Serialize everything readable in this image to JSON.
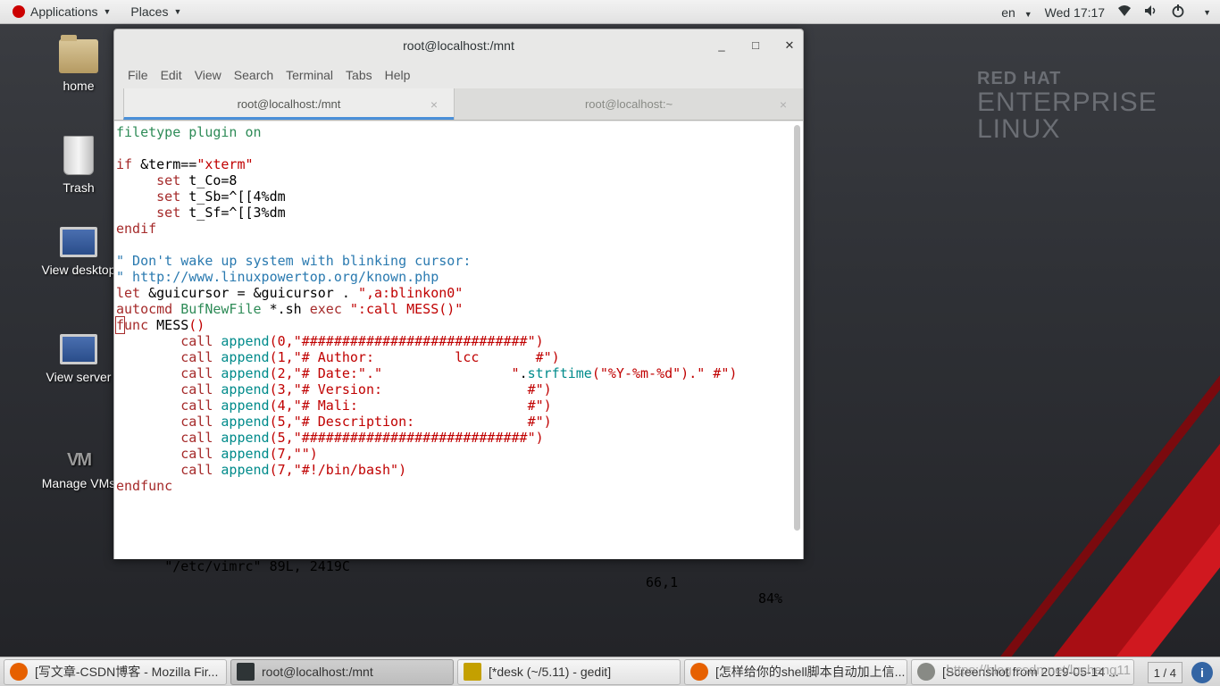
{
  "topbar": {
    "applications": "Applications",
    "places": "Places",
    "lang": "en",
    "clock": "Wed 17:17"
  },
  "desktop": {
    "branding": {
      "line1": "RED HAT",
      "line2": "ENTERPRISE",
      "line3": "LINUX"
    },
    "icons": [
      {
        "label": "home"
      },
      {
        "label": "Trash"
      },
      {
        "label": "View desktop"
      },
      {
        "label": "View server"
      },
      {
        "label": "Manage VMs"
      }
    ]
  },
  "window": {
    "title": "root@localhost:/mnt",
    "menu": [
      "File",
      "Edit",
      "View",
      "Search",
      "Terminal",
      "Tabs",
      "Help"
    ],
    "tabs": [
      {
        "label": "root@localhost:/mnt",
        "close": "×"
      },
      {
        "label": "root@localhost:~",
        "close": "×"
      }
    ],
    "vim": {
      "lines": [
        [
          {
            "t": "filetype plugin on",
            "c": "tp"
          }
        ],
        [],
        [
          {
            "t": "if",
            "c": "kw"
          },
          {
            "t": " &term==",
            "c": ""
          },
          {
            "t": "\"xterm\"",
            "c": "str"
          }
        ],
        [
          {
            "t": "     ",
            "c": ""
          },
          {
            "t": "set",
            "c": "kw"
          },
          {
            "t": " t_Co=8",
            "c": ""
          }
        ],
        [
          {
            "t": "     ",
            "c": ""
          },
          {
            "t": "set",
            "c": "kw"
          },
          {
            "t": " t_Sb=^[[4%dm",
            "c": ""
          }
        ],
        [
          {
            "t": "     ",
            "c": ""
          },
          {
            "t": "set",
            "c": "kw"
          },
          {
            "t": " t_Sf=^[[3%dm",
            "c": ""
          }
        ],
        [
          {
            "t": "endif",
            "c": "kw"
          }
        ],
        [],
        [
          {
            "t": "\" Don't wake up system with blinking cursor:",
            "c": "cm"
          }
        ],
        [
          {
            "t": "\" http://www.linuxpowertop.org/known.php",
            "c": "cm"
          }
        ],
        [
          {
            "t": "let",
            "c": "kw"
          },
          {
            "t": " &guicursor = &guicursor . ",
            "c": ""
          },
          {
            "t": "\",a:blinkon0\"",
            "c": "str"
          }
        ],
        [
          {
            "t": "autocmd",
            "c": "kw"
          },
          {
            "t": " ",
            "c": ""
          },
          {
            "t": "BufNewFile",
            "c": "tp"
          },
          {
            "t": " *.sh ",
            "c": ""
          },
          {
            "t": "exec",
            "c": "kw"
          },
          {
            "t": " ",
            "c": ""
          },
          {
            "t": "\":call MESS()\"",
            "c": "str"
          }
        ],
        [
          {
            "t": "f",
            "c": "kw cursor"
          },
          {
            "t": "unc",
            "c": "kw"
          },
          {
            "t": " MESS",
            "c": ""
          },
          {
            "t": "()",
            "c": "str"
          }
        ],
        [
          {
            "t": "        ",
            "c": ""
          },
          {
            "t": "call",
            "c": "kw"
          },
          {
            "t": " ",
            "c": ""
          },
          {
            "t": "append",
            "c": "fn"
          },
          {
            "t": "(0,",
            "c": "str"
          },
          {
            "t": "\"############################\"",
            "c": "str"
          },
          {
            "t": ")",
            "c": "str"
          }
        ],
        [
          {
            "t": "        ",
            "c": ""
          },
          {
            "t": "call",
            "c": "kw"
          },
          {
            "t": " ",
            "c": ""
          },
          {
            "t": "append",
            "c": "fn"
          },
          {
            "t": "(1,",
            "c": "str"
          },
          {
            "t": "\"# Author:          lcc       #\"",
            "c": "str"
          },
          {
            "t": ")",
            "c": "str"
          }
        ],
        [
          {
            "t": "        ",
            "c": ""
          },
          {
            "t": "call",
            "c": "kw"
          },
          {
            "t": " ",
            "c": ""
          },
          {
            "t": "append",
            "c": "fn"
          },
          {
            "t": "(2,",
            "c": "str"
          },
          {
            "t": "\"# Date:\".\"                \"",
            "c": "str"
          },
          {
            "t": ".",
            "c": ""
          },
          {
            "t": "strftime",
            "c": "fn"
          },
          {
            "t": "(\"%Y-%m-%d\").\" #\")",
            "c": "str"
          }
        ],
        [
          {
            "t": "        ",
            "c": ""
          },
          {
            "t": "call",
            "c": "kw"
          },
          {
            "t": " ",
            "c": ""
          },
          {
            "t": "append",
            "c": "fn"
          },
          {
            "t": "(3,",
            "c": "str"
          },
          {
            "t": "\"# Version:                  #\"",
            "c": "str"
          },
          {
            "t": ")",
            "c": "str"
          }
        ],
        [
          {
            "t": "        ",
            "c": ""
          },
          {
            "t": "call",
            "c": "kw"
          },
          {
            "t": " ",
            "c": ""
          },
          {
            "t": "append",
            "c": "fn"
          },
          {
            "t": "(4,",
            "c": "str"
          },
          {
            "t": "\"# Mali:                     #\"",
            "c": "str"
          },
          {
            "t": ")",
            "c": "str"
          }
        ],
        [
          {
            "t": "        ",
            "c": ""
          },
          {
            "t": "call",
            "c": "kw"
          },
          {
            "t": " ",
            "c": ""
          },
          {
            "t": "append",
            "c": "fn"
          },
          {
            "t": "(5,",
            "c": "str"
          },
          {
            "t": "\"# Description:              #\"",
            "c": "str"
          },
          {
            "t": ")",
            "c": "str"
          }
        ],
        [
          {
            "t": "        ",
            "c": ""
          },
          {
            "t": "call",
            "c": "kw"
          },
          {
            "t": " ",
            "c": ""
          },
          {
            "t": "append",
            "c": "fn"
          },
          {
            "t": "(5,",
            "c": "str"
          },
          {
            "t": "\"############################\"",
            "c": "str"
          },
          {
            "t": ")",
            "c": "str"
          }
        ],
        [
          {
            "t": "        ",
            "c": ""
          },
          {
            "t": "call",
            "c": "kw"
          },
          {
            "t": " ",
            "c": ""
          },
          {
            "t": "append",
            "c": "fn"
          },
          {
            "t": "(7,",
            "c": "str"
          },
          {
            "t": "\"\"",
            "c": "str"
          },
          {
            "t": ")",
            "c": "str"
          }
        ],
        [
          {
            "t": "        ",
            "c": ""
          },
          {
            "t": "call",
            "c": "kw"
          },
          {
            "t": " ",
            "c": ""
          },
          {
            "t": "append",
            "c": "fn"
          },
          {
            "t": "(7,",
            "c": "str"
          },
          {
            "t": "\"#!/bin/bash\"",
            "c": "str"
          },
          {
            "t": ")",
            "c": "str"
          }
        ],
        [
          {
            "t": "endfunc",
            "c": "kw"
          }
        ]
      ],
      "status_file": "\"/etc/vimrc\" 89L, 2419C",
      "status_pos": "66,1",
      "status_pct": "84%"
    }
  },
  "taskbar": {
    "tasks": [
      {
        "label": "[写文章-CSDN博客 - Mozilla Fir...",
        "icon": "firefox-icon",
        "color": "#e66000"
      },
      {
        "label": "root@localhost:/mnt",
        "icon": "terminal-icon",
        "color": "#2e3436"
      },
      {
        "label": "[*desk (~/5.11) - gedit]",
        "icon": "gedit-icon",
        "color": "#c4a000"
      },
      {
        "label": "[怎样给你的shell脚本自动加上信...",
        "icon": "firefox-icon",
        "color": "#e66000"
      },
      {
        "label": "[Screenshot from 2019-05-14 ...",
        "icon": "screenshot-icon",
        "color": "#888a85"
      }
    ],
    "workspace": "1 / 4",
    "watermark": "https://blog.csdn.net/lucheng11"
  }
}
